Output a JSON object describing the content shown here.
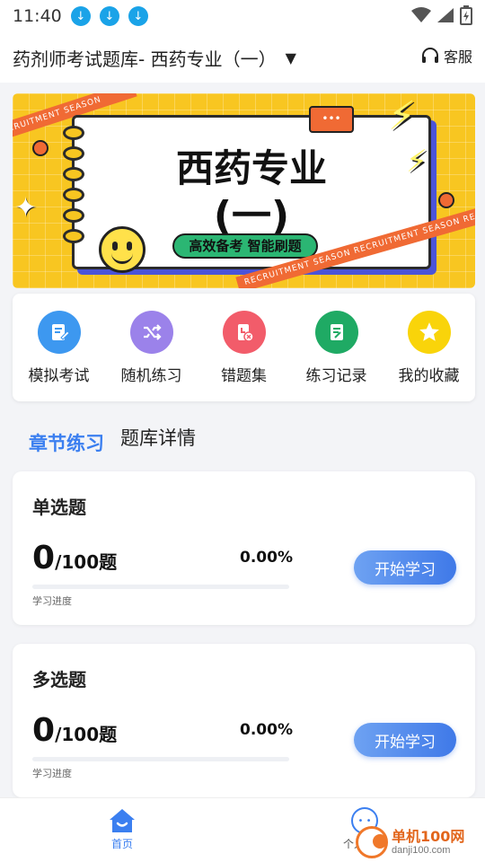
{
  "status_bar": {
    "time": "11:40",
    "download_icons": [
      "download-icon",
      "download-icon",
      "download-icon"
    ]
  },
  "header": {
    "title": "药剂师考试题库- 西药专业（一）",
    "service_label": "客服"
  },
  "banner": {
    "title": "西药专业",
    "subtitle": "(一)",
    "tag": "高效备考 智能刷题",
    "ribbon_text": "RECRUITMENT SEASON",
    "ribbon_text_long": "RECRUITMENT SEASON  RECRUITMENT SEASON  RE",
    "bubble": "•••"
  },
  "quick_actions": [
    {
      "label": "模拟考试",
      "icon": "edit-doc-icon",
      "color": "#3d98f0"
    },
    {
      "label": "随机练习",
      "icon": "shuffle-icon",
      "color": "#9b82ea"
    },
    {
      "label": "错题集",
      "icon": "wrong-question-icon",
      "color": "#f25c6a"
    },
    {
      "label": "练习记录",
      "icon": "record-icon",
      "color": "#1faa64"
    },
    {
      "label": "我的收藏",
      "icon": "star-icon",
      "color": "#f9d40a"
    }
  ],
  "tabs": {
    "active": "章节练习",
    "other": "题库详情"
  },
  "question_cards": [
    {
      "title": "单选题",
      "count": "0",
      "total": "/100题",
      "percent": "0.00%",
      "progress": 0,
      "progress_label": "学习进度",
      "button": "开始学习"
    },
    {
      "title": "多选题",
      "count": "0",
      "total": "/100题",
      "percent": "0.00%",
      "progress": 0,
      "progress_label": "学习进度",
      "button": "开始学习"
    }
  ],
  "bottom_nav": {
    "home": "首页",
    "me": "个人中心"
  },
  "watermark": {
    "title": "单机100网",
    "url": "danji100.com"
  },
  "colors": {
    "accent": "#3b7ff0",
    "banner_bg": "#f8c621",
    "ribbon": "#f06a34"
  }
}
